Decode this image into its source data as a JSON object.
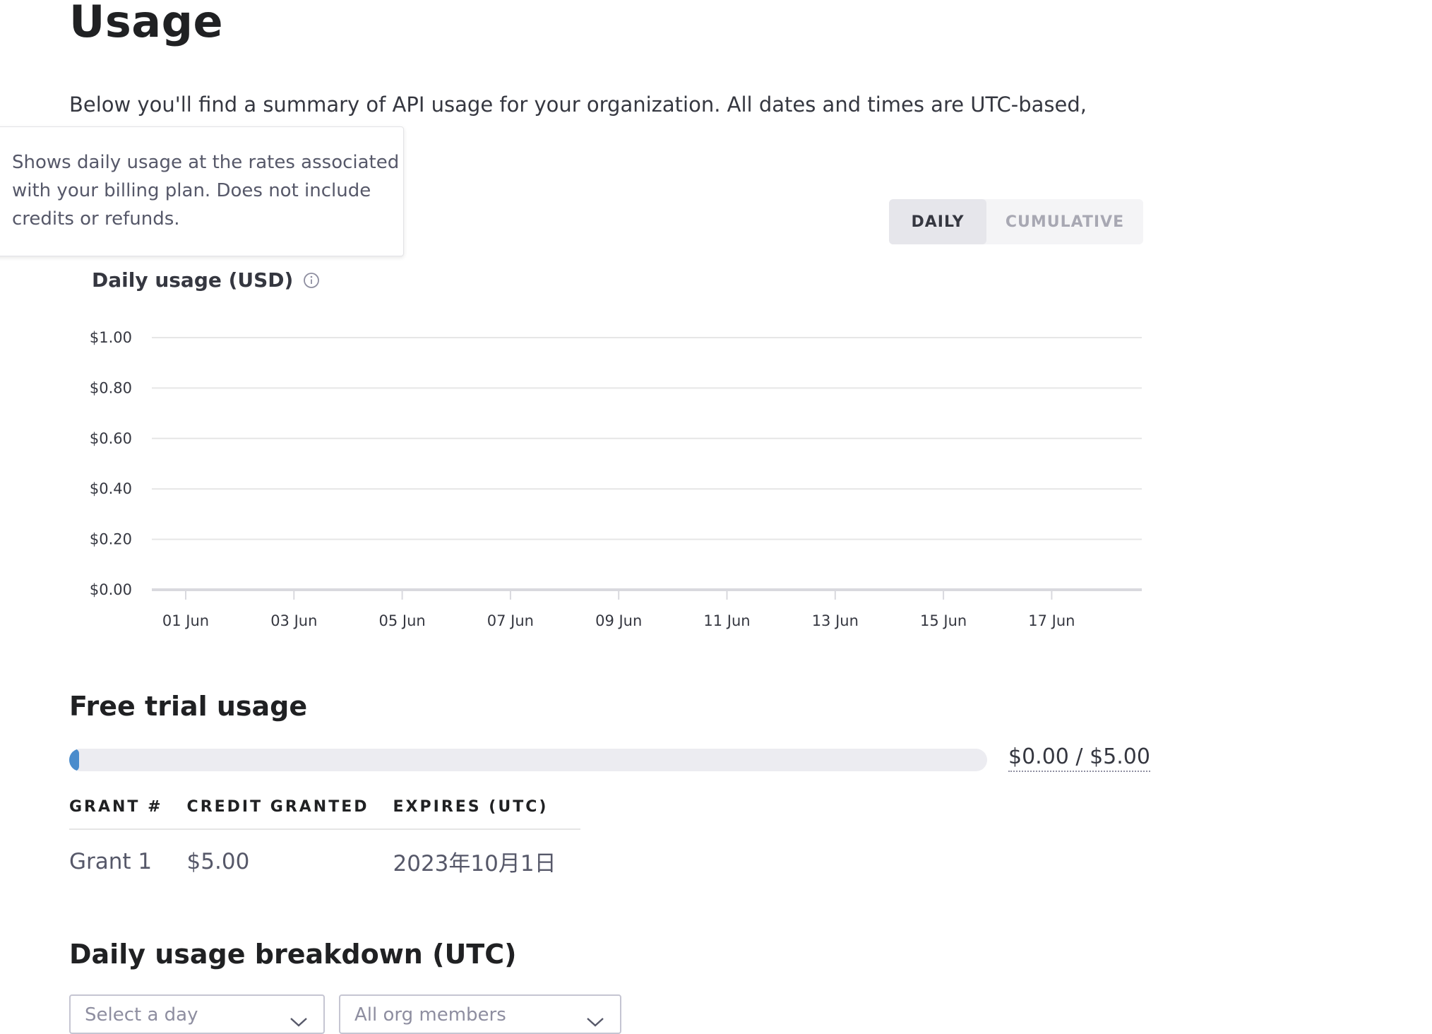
{
  "page": {
    "title": "Usage",
    "intro": "Below you'll find a summary of API usage for your organization. All dates and times are UTC-based, minutes."
  },
  "tooltip": {
    "text": "Shows daily usage at the rates associated with your billing plan. Does not include credits or refunds."
  },
  "view_toggle": {
    "options": [
      {
        "label": "DAILY",
        "active": true
      },
      {
        "label": "CUMULATIVE",
        "active": false
      }
    ]
  },
  "chart_title": "Daily usage (USD)",
  "chart_data": {
    "type": "bar",
    "title": "Daily usage (USD)",
    "xlabel": "",
    "ylabel": "",
    "ylim": [
      0,
      1.0
    ],
    "y_ticks": [
      "$0.00",
      "$0.20",
      "$0.40",
      "$0.60",
      "$0.80",
      "$1.00"
    ],
    "categories": [
      "01 Jun",
      "03 Jun",
      "05 Jun",
      "07 Jun",
      "09 Jun",
      "11 Jun",
      "13 Jun",
      "15 Jun",
      "17 Jun"
    ],
    "values": [
      0,
      0,
      0,
      0,
      0,
      0,
      0,
      0,
      0
    ],
    "grid": true
  },
  "free_trial": {
    "heading": "Free trial usage",
    "used_fraction": 0.0,
    "label": "$0.00 / $5.00",
    "accent_color": "#4a8ccc"
  },
  "grants_table": {
    "headers": [
      "GRANT #",
      "CREDIT GRANTED",
      "EXPIRES (UTC)"
    ],
    "rows": [
      [
        "Grant 1",
        "$5.00",
        "2023年10月1日"
      ]
    ]
  },
  "breakdown": {
    "heading": "Daily usage breakdown (UTC)",
    "day_select_placeholder": "Select a day",
    "members_select_value": "All org members"
  }
}
